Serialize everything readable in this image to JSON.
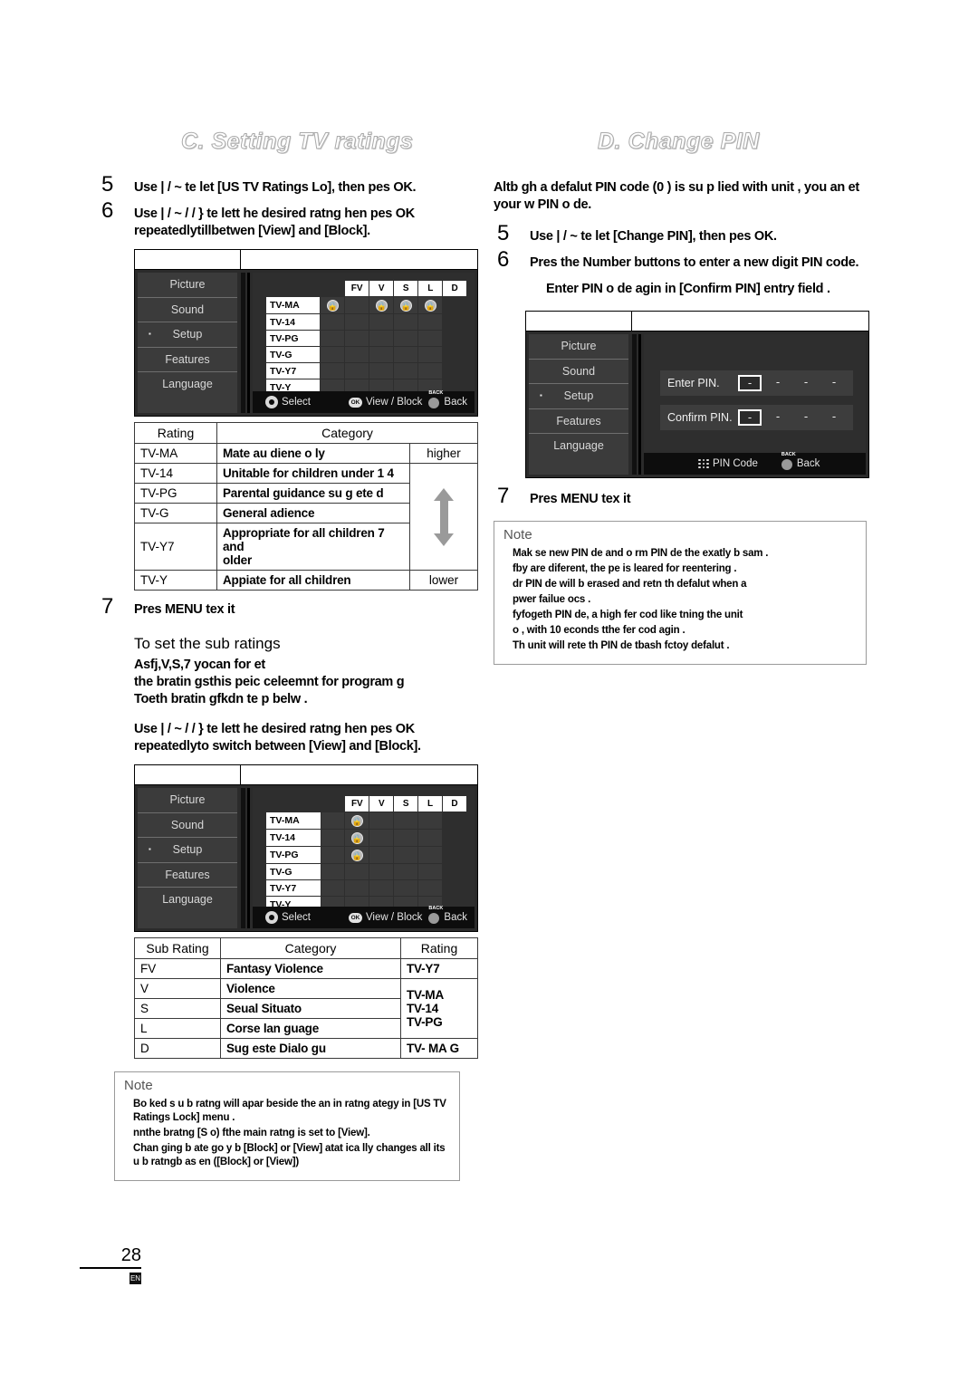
{
  "page": {
    "number": "28",
    "footer_glyph": "EN"
  },
  "left": {
    "title": "C. Setting TV ratings",
    "steps": [
      {
        "num": "5",
        "text": "Use | / ~ te  let [US TV Ratings Lo], then pes  OK."
      },
      {
        "num": "6",
        "text": "Use | / ~ /  / } te   lett he desired ratng hen pes OK repeatedlytillbetwen        [View] and [Block]."
      },
      {
        "num": "7",
        "text": "Pres MENU tex  it"
      }
    ],
    "osd1": {
      "sidebar": [
        "Picture",
        "Sound",
        "Setup",
        "Features",
        "Language"
      ],
      "selected_sidebar": "Setup",
      "grid": {
        "columns": [
          "",
          "FV",
          "V",
          "S",
          "L",
          "D"
        ],
        "rows": [
          {
            "label": "TV-MA",
            "locks": [
              true,
              false,
              true,
              true,
              true,
              false
            ]
          },
          {
            "label": "TV-14",
            "locks": [
              false,
              false,
              false,
              false,
              false,
              false
            ]
          },
          {
            "label": "TV-PG",
            "locks": [
              false,
              false,
              false,
              false,
              false,
              false
            ]
          },
          {
            "label": "TV-G",
            "locks": [
              false,
              false,
              false,
              false,
              false,
              false
            ]
          },
          {
            "label": "TV-Y7",
            "locks": [
              false,
              false,
              false,
              false,
              false,
              false
            ]
          },
          {
            "label": "TV-Y",
            "locks": [
              false,
              false,
              false,
              false,
              false,
              false
            ]
          }
        ]
      },
      "hints": [
        "Select",
        "View / Block",
        "Back"
      ]
    },
    "ratings_table": {
      "headers": [
        "Rating",
        "Category",
        ""
      ],
      "scale_top": "higher",
      "scale_bottom": "lower",
      "rows": [
        {
          "rating": "TV-MA",
          "category": "Mate au diene o ly"
        },
        {
          "rating": "TV-14",
          "category": "Unitable for children under 1       4"
        },
        {
          "rating": "TV-PG",
          "category": "Parental guidance su g ete d"
        },
        {
          "rating": "TV-G",
          "category": "General adience"
        },
        {
          "rating": "TV-Y7",
          "category": "Appropriate for all children 7 and\nolder"
        },
        {
          "rating": "TV-Y",
          "category": "Appiate for all children"
        }
      ]
    },
    "sub_section": {
      "heading": "To set the sub ratings",
      "paragraph": "Asfj,V,S,7                         yocan for et\nthe bratin    gsthis        peic celeemnt for    program  g\nToeth bratin        gfkdn te          p belw .",
      "instruction": "Use | / ~ /  / } te   lett he desired ratng hen pes OK repeatedlyto  switch between  [View] and [Block]."
    },
    "osd2": {
      "sidebar": [
        "Picture",
        "Sound",
        "Setup",
        "Features",
        "Language"
      ],
      "selected_sidebar": "Setup",
      "grid": {
        "columns": [
          "",
          "FV",
          "V",
          "S",
          "L",
          "D"
        ],
        "rows": [
          {
            "label": "TV-MA",
            "locks": [
              false,
              false,
              true,
              false,
              false,
              false
            ]
          },
          {
            "label": "TV-14",
            "locks": [
              false,
              false,
              true,
              false,
              false,
              false
            ]
          },
          {
            "label": "TV-PG",
            "locks": [
              false,
              false,
              true,
              false,
              false,
              false
            ]
          },
          {
            "label": "TV-G",
            "locks": [
              false,
              false,
              false,
              false,
              false,
              false
            ]
          },
          {
            "label": "TV-Y7",
            "locks": [
              false,
              false,
              false,
              false,
              false,
              false
            ]
          },
          {
            "label": "TV-Y",
            "locks": [
              false,
              false,
              false,
              false,
              false,
              false
            ]
          }
        ]
      },
      "hints": [
        "Select",
        "View / Block",
        "Back"
      ]
    },
    "sub_table": {
      "headers": [
        "Sub Rating",
        "Category",
        "Rating"
      ],
      "rows": [
        {
          "sub": "FV",
          "category": "Fantasy Violence",
          "rating": "TV-Y7"
        },
        {
          "sub": "V",
          "category": "Violence",
          "rating": "TV-MA"
        },
        {
          "sub": "S",
          "category": "Seual Situato",
          "rating": "TV-14"
        },
        {
          "sub": "L",
          "category": "Corse lan  guage",
          "rating": "TV-PG"
        },
        {
          "sub": "D",
          "category": "Sug este Dialo  gu",
          "rating": "TV- MA  G"
        }
      ]
    },
    "note": {
      "title": "Note",
      "items": [
        "Bo ked s u b ratng will apar   beside the an in ratng ategy      in [US TV Ratings Lock] menu .",
        "nnthe bratng [S o) fthe main ratng is set to [View].",
        "Chan ging b ate   go y b [Block] or [View] atat     ica lly changes all its u  b ratngb as en            ([Block] or [View])"
      ]
    }
  },
  "right": {
    "title": "D. Change PIN",
    "intro": "Altb  gh a defalut PIN code       (0    ) is su p lied with unit       ,  you an et your w           PIN o de.",
    "steps": [
      {
        "num": "5",
        "text": "Use | / ~ te  let [Change PIN], then pes  OK."
      },
      {
        "num": "6",
        "text": "Pres the Number buttons to enter a new digit PIN code."
      },
      {
        "num": "7",
        "text": "Pres MENU tex  it"
      }
    ],
    "step6_sub": "Enter PIN o de agin in [Confirm PIN] entry field .",
    "osd": {
      "sidebar": [
        "Picture",
        "Sound",
        "Setup",
        "Features",
        "Language"
      ],
      "selected_sidebar": "Setup",
      "fields": [
        {
          "label": "Enter PIN.",
          "digits": [
            "-",
            "-",
            "-",
            "-"
          ]
        },
        {
          "label": "Confirm PIN.",
          "digits": [
            "-",
            "-",
            "-",
            "-"
          ]
        }
      ],
      "hints": [
        "PIN Code",
        "Back"
      ]
    },
    "note": {
      "title": "Note",
      "items": [
        "Mak se new PIN de and o               rm PIN de the exatly b  sam              .",
        "fby are diferent, the pe is leared for reentering          .",
        "dr PIN de will b erased and retn th defalut when a",
        "pwer failue ocs        .",
        "fyfogeth PIN de, a high fer cod like tning the unit",
        "o , with    10 econds tthe fer cod agin                .",
        "Th unit will rete th PIN de tbash fctoy defalut            ."
      ]
    }
  }
}
